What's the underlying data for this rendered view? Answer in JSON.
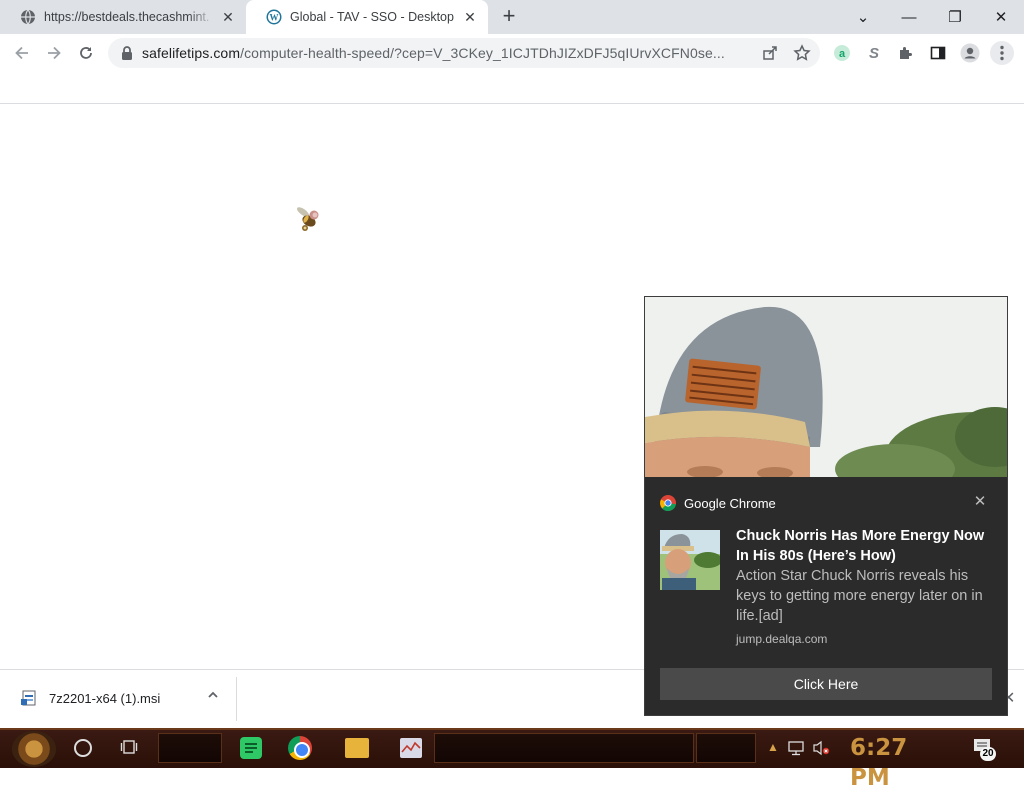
{
  "browser": {
    "tabs": [
      {
        "title": "https://bestdeals.thecashmint.",
        "favicon": "globe-icon",
        "active": false
      },
      {
        "title": "Global - TAV - SSO - Desktop",
        "favicon": "wordpress-icon",
        "active": true
      }
    ],
    "new_tab_symbol": "+",
    "window_controls": {
      "tab_search": "⌄",
      "minimize": "—",
      "restore": "❐",
      "close": "✕"
    },
    "address_bar": {
      "host": "safelifetips.com",
      "path": "/computer-health-speed/?cep=V_3CKey_1ICJTDhJIZxDFJ5qIUrvXCFN0se..."
    },
    "toolbar_icons": [
      "back-icon",
      "forward-icon",
      "reload-icon",
      "lock-icon",
      "share-icon",
      "star-icon",
      "grammarly-icon",
      "extension-s-icon",
      "puzzle-icon",
      "side-panel-icon",
      "profile-icon",
      "kebab-menu-icon"
    ]
  },
  "download_bar": {
    "file_name": "7z2201-x64 (1).msi",
    "close_symbol": "✕"
  },
  "notification": {
    "app_name": "Google Chrome",
    "title": "Chuck Norris Has More Energy Now In His 80s (Here’s How)",
    "body": "Action Star Chuck Norris reveals his keys to getting more energy later on in life.[ad]",
    "source": "jump.dealqa.com",
    "button_label": "Click Here",
    "close_symbol": "✕"
  },
  "taskbar": {
    "clock": "6:27 PM",
    "notification_count": "20",
    "colors": {
      "accent": "#c9933f",
      "background": "#2a1008"
    }
  }
}
